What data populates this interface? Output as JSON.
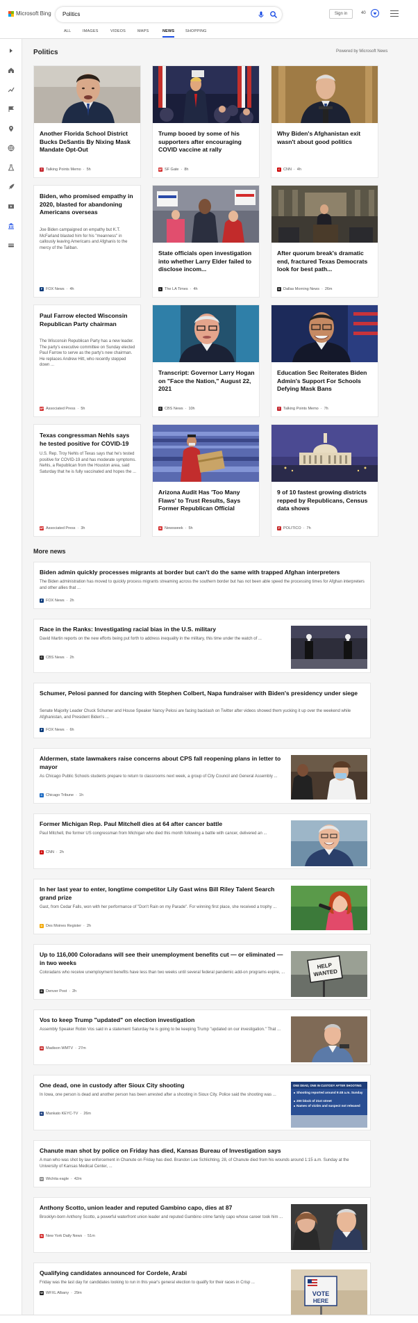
{
  "header": {
    "brand": "Microsoft Bing",
    "search_value": "Politics",
    "sign_in": "Sign in",
    "points": "40"
  },
  "tabs": [
    {
      "label": "ALL"
    },
    {
      "label": "IMAGES"
    },
    {
      "label": "VIDEOS"
    },
    {
      "label": "MAPS"
    },
    {
      "label": "NEWS",
      "active": true
    },
    {
      "label": "SHOPPING"
    }
  ],
  "section": {
    "title": "Politics",
    "powered_by": "Powered by Microsoft News"
  },
  "cards": [
    {
      "title": "Another Florida School District Bucks DeSantis By Nixing Mask Mandate Opt-Out",
      "source": "Talking Points Memo",
      "time": "5h",
      "fav_color": "#c4262e",
      "fav": "T"
    },
    {
      "title": "Trump booed by some of his supporters after encouraging COVID vaccine at rally",
      "source": "SF Gate",
      "time": "8h",
      "fav_color": "#d32f2f",
      "fav": "SF"
    },
    {
      "title": "Why Biden's Afghanistan exit wasn't about good politics",
      "source": "CNN",
      "time": "4h",
      "fav_color": "#cc0000",
      "fav": "C"
    },
    {
      "title": "Biden, who promised empathy in 2020, blasted for abandoning Americans overseas",
      "snippet": "Joe Biden campaigned on empathy but K.T. McFarland blasted him for his \"meanness\" in callously leaving Americans and Afghanis to the mercy of the Taliban.",
      "source": "FOX News",
      "time": "4h",
      "fav_color": "#0a3a7a",
      "fav": "F"
    },
    {
      "title": "State officials open investigation into whether Larry Elder failed to disclose incom...",
      "source": "The LA Times",
      "time": "4h",
      "fav_color": "#222",
      "fav": "L"
    },
    {
      "title": "After quorum break's dramatic end, fractured Texas Democrats look for best path...",
      "source": "Dallas Morning News",
      "time": "26m",
      "fav_color": "#222",
      "fav": "D"
    },
    {
      "title": "Paul Farrow elected Wisconsin Republican Party chairman",
      "snippet": "The Wisconsin Republican Party has a new leader. The party's executive committee on Sunday elected Paul Farrow to serve as the party's new chairman. He replaces Andrew Hitt, who recently stepped down ...",
      "source": "Associated Press",
      "time": "5h",
      "fav_color": "#d32f2f",
      "fav": "AP"
    },
    {
      "title": "Transcript: Governor Larry Hogan on \"Face the Nation,\" August 22, 2021",
      "source": "CBS News",
      "time": "10h",
      "fav_color": "#222",
      "fav": "C"
    },
    {
      "title": "Education Sec Reiterates Biden Admin's Support For Schools Defying Mask Bans",
      "source": "Talking Points Memo",
      "time": "7h",
      "fav_color": "#c4262e",
      "fav": "T"
    },
    {
      "title": "Texas congressman Nehls says he tested positive for COVID-19",
      "snippet": "U.S. Rep. Troy Nehls of Texas says that he's tested positive for COVID-19 and has moderate symptoms. Nehls, a Republican from the Houston area, said Saturday that he is fully vaccinated and hopes the ...",
      "source": "Associated Press",
      "time": "3h",
      "fav_color": "#d32f2f",
      "fav": "AP"
    },
    {
      "title": "Arizona Audit Has 'Too Many Flaws' to Trust Results, Says Former Republican Official",
      "source": "Newsweek",
      "time": "5h",
      "fav_color": "#d32f2f",
      "fav": "N"
    },
    {
      "title": "9 of 10 fastest growing districts repped by Republicans, Census data shows",
      "source": "POLITICO",
      "time": "7h",
      "fav_color": "#c62828",
      "fav": "P"
    }
  ],
  "more_news": {
    "title": "More news",
    "items": [
      {
        "title": "Biden admin quickly processes migrants at border but can't do the same with trapped Afghan interpreters",
        "snippet": "The Biden administration has moved to quickly process migrants streaming across the southern border but has not been able speed the processing times for Afghan interpreters and other allies that ...",
        "source": "FOX News",
        "time": "2h",
        "fav_color": "#0a3a7a",
        "fav": "F"
      },
      {
        "title": "Race in the Ranks: Investigating racial bias in the U.S. military",
        "snippet": "David Martin reports on the new efforts being put forth to address inequality in the military, this time under the watch of ...",
        "source": "CBS News",
        "time": "2h",
        "fav_color": "#222",
        "fav": "C"
      },
      {
        "title": "Schumer, Pelosi panned for dancing with Stephen Colbert, Napa fundraiser with Biden's presidency under siege",
        "snippet": "Senate Majority Leader Chuck Schumer and House Speaker Nancy Pelosi are facing backlash on Twitter after videos showed them yucking it up over the weekend while Afghanistan, and President Biden's ...",
        "source": "FOX News",
        "time": "6h",
        "fav_color": "#0a3a7a",
        "fav": "F"
      },
      {
        "title": "Aldermen, state lawmakers raise concerns about CPS fall reopening plans in letter to mayor",
        "snippet": "As Chicago Public Schools students prepare to return to classrooms next week, a group of City Council and General Assembly ...",
        "source": "Chicago Tribune",
        "time": "1h",
        "fav_color": "#1565c0",
        "fav": "C"
      },
      {
        "title": "Former Michigan Rep. Paul Mitchell dies at 64 after cancer battle",
        "snippet": "Paul Mitchell, the former US congressman from Michigan who died this month following a battle with cancer, delivered an ...",
        "source": "CNN",
        "time": "2h",
        "fav_color": "#cc0000",
        "fav": "C"
      },
      {
        "title": "In her last year to enter, longtime competitor Lily Gast wins Bill Riley Talent Search grand prize",
        "snippet": "Gast, from Cedar Falls, won with her performance of \"Don't Rain on my Parade\". For winning first place, she received a trophy ...",
        "source": "Des Moines Register",
        "time": "2h",
        "fav_color": "#f2a600",
        "fav": "D"
      },
      {
        "title": "Up to 116,000 Coloradans will see their unemployment benefits cut — or eliminated — in two weeks",
        "snippet": "Coloradans who receive unemployment benefits have less than two weeks until several federal pandemic add-on programs expire, ...",
        "source": "Denver Post",
        "time": "2h",
        "fav_color": "#222",
        "fav": "D"
      },
      {
        "title": "Vos to keep Trump \"updated\" on election investigation",
        "snippet": "Assembly Speaker Robin Vos said in a statement Saturday he is going to be keeping Trump \"updated on our investigation.\" That ...",
        "source": "Madison WMTV",
        "time": "27m",
        "fav_color": "#c62828",
        "fav": "M"
      },
      {
        "title": "One dead, one in custody after Sioux City shooting",
        "snippet": "In Iowa, one person is dead and another person has been arrested after a shooting in Sioux City. Police said the shooting was ...",
        "source": "Mankato KEYC-TV",
        "time": "26m",
        "fav_color": "#1a3d7c",
        "fav": "K"
      },
      {
        "title": "Chanute man shot by police on Friday has died, Kansas Bureau of Investigation says",
        "snippet": "A man who was shot by law enforcement in Chanute on Friday has died. Brandon Lee Schlichting, 28, of Chanute died from his wounds around 1:15 a.m. Sunday at the University of Kansas Medical Center, ...",
        "source": "Wichita eagle",
        "time": "42m",
        "fav_color": "#888",
        "fav": "W"
      },
      {
        "title": "Anthony Scotto, union leader and reputed Gambino capo, dies at 87",
        "snippet": "Brooklyn-born Anthony Scotto, a powerful waterfront union leader and reputed Gambino crime family capo whose career took him ...",
        "source": "New York Daily News",
        "time": "51m",
        "fav_color": "#d32f2f",
        "fav": "N"
      },
      {
        "title": "Qualifying candidates announced for Cordele, Arabi",
        "snippet": "Friday was the last day for candidates looking to run in this year's general election to qualify for their races in Crisp ...",
        "source": "WFXL Albany",
        "time": "29m",
        "fav_color": "#222",
        "fav": "W"
      }
    ]
  },
  "thumb_texts": {
    "sioux_headline": "ONE DEAD, ONE IN CUSTODY AFTER SHOOTING",
    "sioux_bullets": [
      "Shooting reported around 9:48 a.m. Sunday",
      "200 block of 21st street",
      "Names of victim and suspect not released"
    ],
    "help_wanted_1": "HELP",
    "help_wanted_2": "WANTED",
    "vote_1": "VOTE",
    "vote_2": "HERE"
  },
  "colors": {
    "accent": "#174ae4"
  }
}
